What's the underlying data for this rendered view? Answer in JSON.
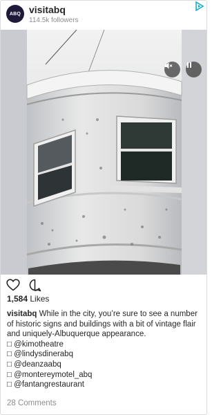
{
  "header": {
    "avatar_text": "ABQ",
    "username": "visitabq",
    "followers": "114.5k followers",
    "ad_icon": "adchoices-icon"
  },
  "media": {
    "controls": {
      "mute_icon": "mute-icon",
      "pause_icon": "pause-icon"
    }
  },
  "actions": {
    "like_icon": "heart-icon",
    "comment_icon": "comment-bubble-icon"
  },
  "likes": {
    "count": "1,584",
    "label": "Likes"
  },
  "caption": {
    "author": "visitabq",
    "text": "While in the city, you’re sure to see a number of historic signs and buildings with a bit of vintage flair and uniquely-Albuquerque appearance.",
    "mentions": [
      "□ @kimotheatre",
      "□ @lindysdinerabq",
      "□ @deanzaabq",
      "□ @montereymotel_abq",
      "□ @fantangrestaurant"
    ]
  },
  "comments_link": "28 Comments",
  "colors": {
    "text": "#262626",
    "muted": "#8e8e8e",
    "border": "#dbdbdb",
    "ad_blue": "#00aecd"
  }
}
